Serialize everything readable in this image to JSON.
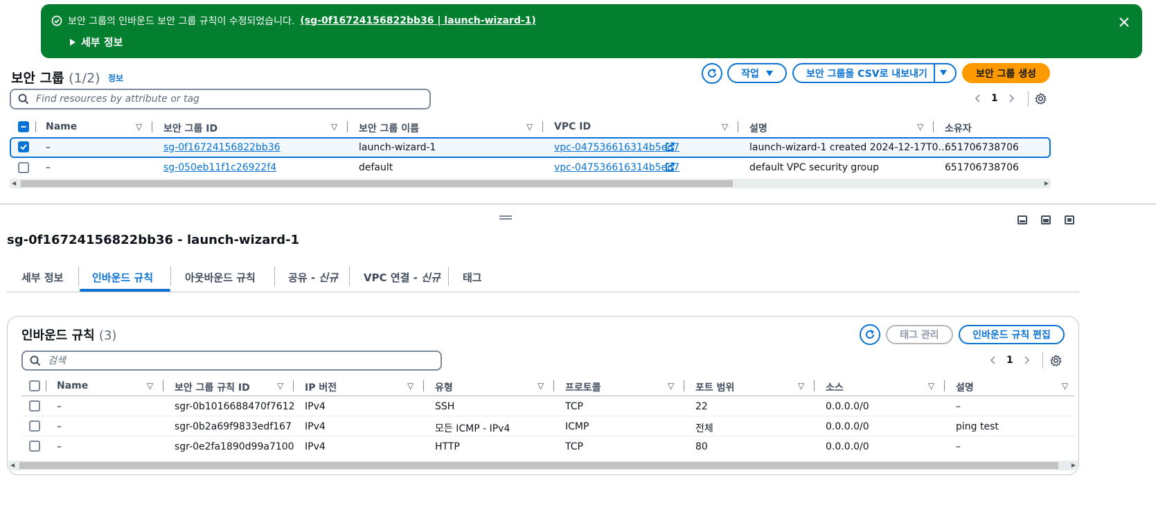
{
  "flash": {
    "message": "보안 그룹의 인바운드 보안 그룹 규칙이 수정되었습니다.",
    "link": "(sg-0f16724156822bb36 | launch-wizard-1)",
    "details": "세부 정보"
  },
  "header": {
    "title": "보안 그룹",
    "count": "(1/2)",
    "info": "정보",
    "actions_label": "작업",
    "export_label": "보안 그룹을 CSV로 내보내기",
    "create_label": "보안 그룹 생성"
  },
  "search": {
    "placeholder": "Find resources by attribute or tag"
  },
  "pager": {
    "page": "1"
  },
  "sg_table": {
    "columns": [
      "Name",
      "보안 그룹 ID",
      "보안 그룹 이름",
      "VPC ID",
      "설명",
      "소유자"
    ],
    "rows": [
      {
        "selected": true,
        "name": "–",
        "id": "sg-0f16724156822bb36",
        "group_name": "launch-wizard-1",
        "vpc": "vpc-047536616314b5ed7",
        "desc": "launch-wizard-1 created 2024-12-17T0…",
        "owner": "651706738706"
      },
      {
        "selected": false,
        "name": "–",
        "id": "sg-050eb11f1c26922f4",
        "group_name": "default",
        "vpc": "vpc-047536616314b5ed7",
        "desc": "default VPC security group",
        "owner": "651706738706"
      }
    ]
  },
  "detail": {
    "title": "sg-0f16724156822bb36 - launch-wizard-1",
    "tabs": [
      {
        "label": "세부 정보"
      },
      {
        "label": "인바운드 규칙"
      },
      {
        "label": "아웃바운드 규칙"
      },
      {
        "label": "공유 - ",
        "suffix": "신규"
      },
      {
        "label": "VPC 연결 - ",
        "suffix": "신규"
      },
      {
        "label": "태그"
      }
    ]
  },
  "inbound": {
    "title": "인바운드 규칙",
    "count": "(3)",
    "manage_tags": "태그 관리",
    "edit_label": "인바운드 규칙 편집",
    "search_placeholder": "검색",
    "page": "1",
    "columns": [
      "Name",
      "보안 그룹 규칙 ID",
      "IP 버전",
      "유형",
      "프로토콜",
      "포트 범위",
      "소스",
      "설명"
    ],
    "rows": [
      {
        "name": "–",
        "id": "sgr-0b1016688470f7612",
        "ip": "IPv4",
        "type": "SSH",
        "proto": "TCP",
        "port": "22",
        "source": "0.0.0.0/0",
        "desc": "–"
      },
      {
        "name": "–",
        "id": "sgr-0b2a69f9833edf167",
        "ip": "IPv4",
        "type": "모든 ICMP - IPv4",
        "proto": "ICMP",
        "port": "전체",
        "source": "0.0.0.0/0",
        "desc": "ping test"
      },
      {
        "name": "–",
        "id": "sgr-0e2fa1890d99a7100",
        "ip": "IPv4",
        "type": "HTTP",
        "proto": "TCP",
        "port": "80",
        "source": "0.0.0.0/0",
        "desc": "–"
      }
    ]
  },
  "colors": {
    "accent": "#0972d3",
    "success": "#037f2f",
    "primary_button": "#ff9900"
  }
}
